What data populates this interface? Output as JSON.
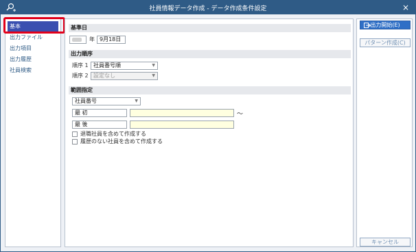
{
  "window": {
    "title": "社員情報データ作成 - データ作成条件設定",
    "close_glyph": "×"
  },
  "sidebar": {
    "items": [
      {
        "label": "基本",
        "active": true
      },
      {
        "label": "出力ファイル"
      },
      {
        "label": "出力項目"
      },
      {
        "label": "出力履歴"
      },
      {
        "label": "社員検索"
      }
    ]
  },
  "main": {
    "base_date": {
      "heading": "基準日",
      "year_label": "年",
      "date_value": "9月18日"
    },
    "order": {
      "heading": "出力順序",
      "rows": [
        {
          "label": "順序 1",
          "value": "社員番号順",
          "disabled": false
        },
        {
          "label": "順序 2",
          "value": "設定なし",
          "disabled": true
        }
      ]
    },
    "range": {
      "heading": "範囲指定",
      "field_select": "社員番号",
      "first_label": "最 初",
      "last_label": "最 後",
      "tilde": "～",
      "options": [
        {
          "label": "退職社員を含めて作成する"
        },
        {
          "label": "履歴のない社員を含めて作成する"
        }
      ]
    }
  },
  "right": {
    "start_button": "出力開始(E)",
    "pattern_button": "パターン作成(C)",
    "cancel_button": "キャンセル"
  },
  "colors": {
    "titlebar": "#2f5b86",
    "active_item": "#3a4fb0",
    "highlight": "#e2001a",
    "primary_button": "#2f6fc6"
  }
}
